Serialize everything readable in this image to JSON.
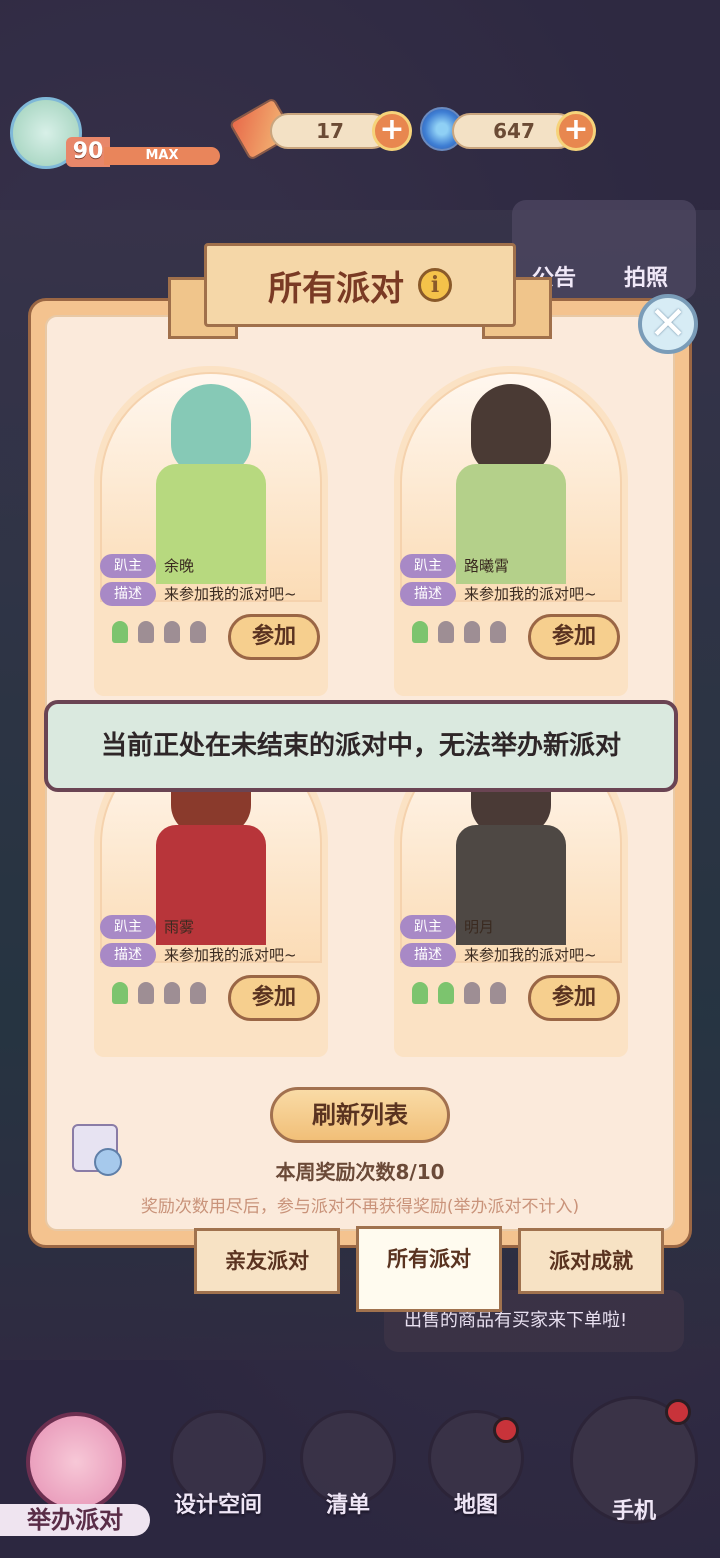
{
  "hud": {
    "level": "90",
    "level_status": "MAX",
    "tickets": "17",
    "crystals": "647"
  },
  "side": {
    "notice": "公告",
    "photo": "拍照"
  },
  "dialog": {
    "title": "所有派对",
    "refresh_label": "刷新列表",
    "weekly_rewards": "本周奖励次数8/10",
    "note": "奖励次数用尽后，参与派对不再获得奖励(举办派对不计入)",
    "host_tag": "趴主",
    "desc_tag": "描述",
    "join_label": "参加",
    "parties": [
      {
        "host": "余晚",
        "desc": "来参加我的派对吧~",
        "joined": 1,
        "capacity": 4
      },
      {
        "host": "路曦霄",
        "desc": "来参加我的派对吧~",
        "joined": 1,
        "capacity": 4
      },
      {
        "host": "雨雾",
        "desc": "来参加我的派对吧~",
        "joined": 1,
        "capacity": 4
      },
      {
        "host": "明月",
        "desc": "来参加我的派对吧~",
        "joined": 2,
        "capacity": 4
      }
    ],
    "tabs": [
      "亲友派对",
      "所有派对",
      "派对成就"
    ],
    "active_tab": "所有派对"
  },
  "toast": "当前正处在未结束的派对中，无法举办新派对",
  "bubble": "出售的商品有买家来下单啦!",
  "bottom_nav": {
    "host": "举办派对",
    "design": "设计空间",
    "list": "清单",
    "map": "地图",
    "phone": "手机"
  },
  "colors": {
    "accent": "#f4c38f",
    "join_green": "#7cc46e",
    "tag_purple": "#a889c6",
    "badge_red": "#c8333a"
  }
}
